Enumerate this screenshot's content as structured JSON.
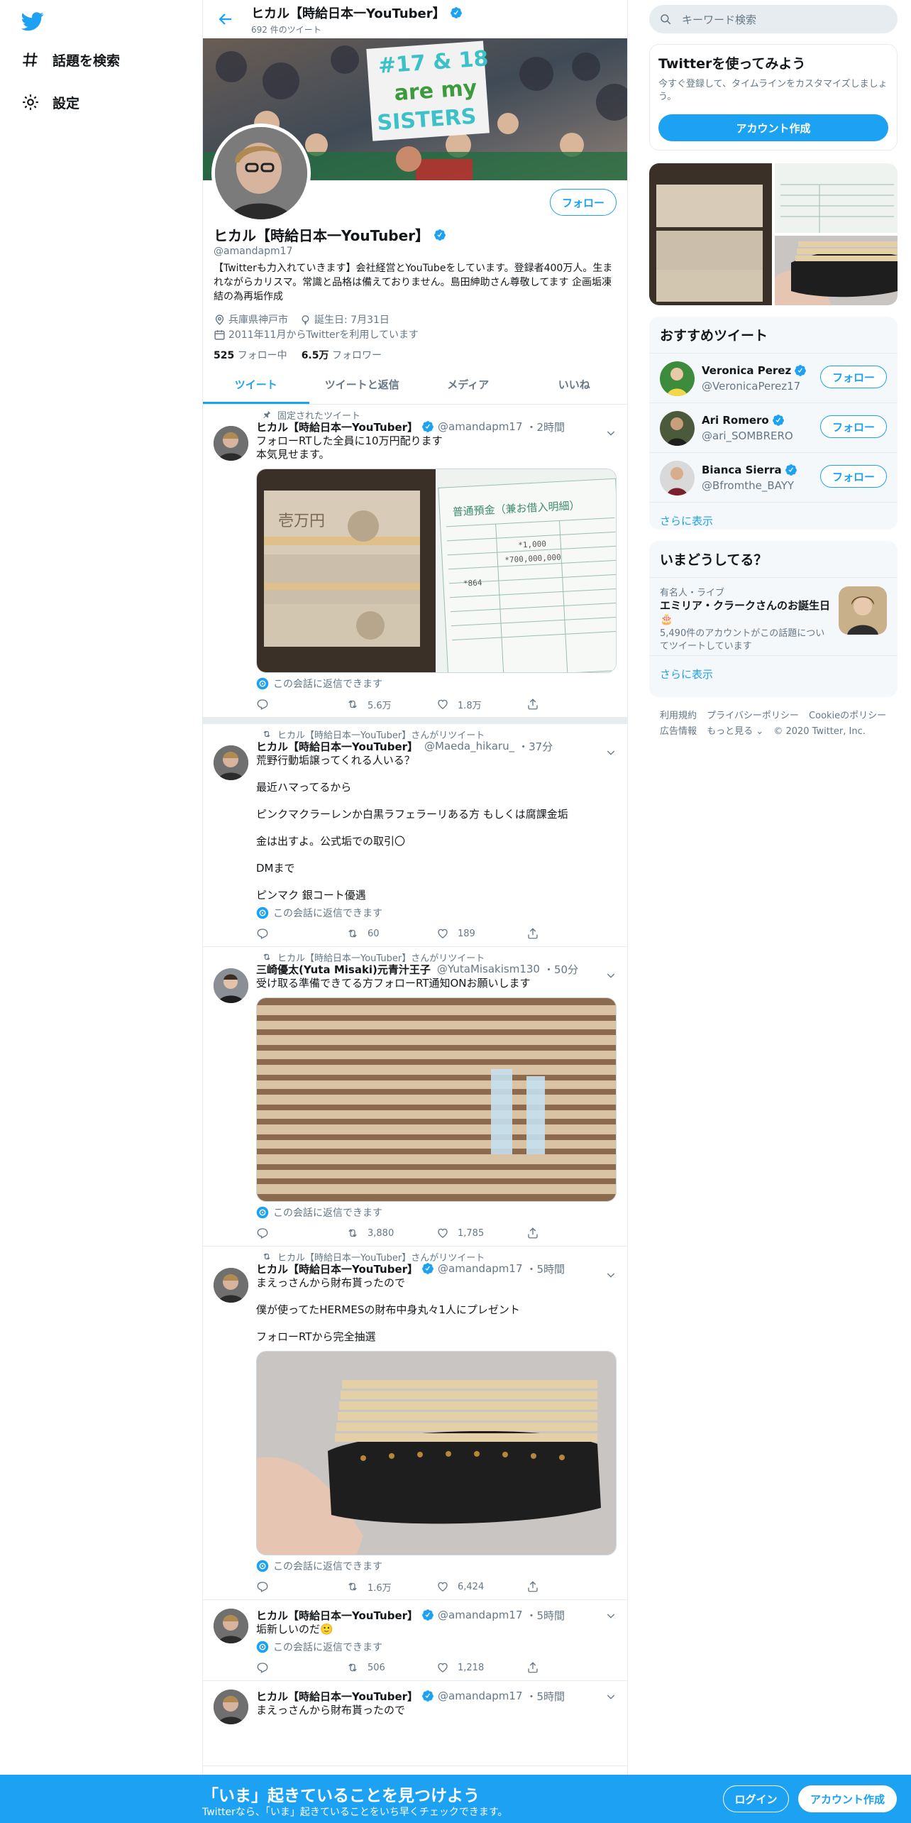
{
  "nav": {
    "logo": "twitter-bird-icon",
    "items": [
      {
        "label": "話題を検索",
        "icon": "hashtag-icon"
      },
      {
        "label": "設定",
        "icon": "gear-icon"
      }
    ]
  },
  "header": {
    "name": "ヒカル【時給日本一YouTuber】",
    "tweet_count": "692 件のツイート"
  },
  "banner": {
    "sign_line1": "#17 & 18",
    "sign_line2": "are my",
    "sign_line3": "SISTERS"
  },
  "profile": {
    "follow_label": "フォロー",
    "name": "ヒカル【時給日本一YouTuber】",
    "handle": "@amandapm17",
    "bio": "【Twitterも力入れていきます】会社経営とYouTubeをしています。登録者400万人。生まれながらカリスマ。常識と品格は備えておりません。島田紳助さん尊敬してます 企画垢凍結の為再垢作成",
    "location": "兵庫県神戸市",
    "birthday": "誕生日: 7月31日",
    "joined": "2011年11月からTwitterを利用しています",
    "following_count": "525",
    "following_label": "フォロー中",
    "followers_count": "6.5万",
    "followers_label": "フォロワー"
  },
  "tabs": [
    "ツイート",
    "ツイートと返信",
    "メディア",
    "いいね"
  ],
  "tweets": [
    {
      "context": "固定されたツイート",
      "name": "ヒカル【時給日本一YouTuber】",
      "handle": "@amandapm17",
      "time": "・2時間",
      "text": "フォローRTした全員に10万円配ります\n本気見せます。",
      "reply_note": "この会話に返信できます",
      "retweets": "5.6万",
      "likes": "1.8万",
      "media": {
        "bank_header": "普通預金（兼お借入明細）",
        "amount1": "*1,000",
        "amount2": "*700,000,000",
        "amount3": "*864"
      }
    },
    {
      "context": "ヒカル【時給日本一YouTuber】さんがリツイート",
      "name": "ヒカル【時給日本一YouTuber】",
      "handle": "@Maeda_hikaru_",
      "time": "・37分",
      "text": "荒野行動垢譲ってくれる人いる？\n\n最近ハマってるから\n\nピンクマクラーレンか白黒ラフェラーリある方 もしくは腐課金垢\n\n金は出すよ。公式垢での取引〇\n\nDMまで\n\nピンマク 銀コート優遇",
      "reply_note": "この会話に返信できます",
      "retweets": "60",
      "likes": "189"
    },
    {
      "context": "ヒカル【時給日本一YouTuber】さんがリツイート",
      "name": "三崎優太(Yuta Misaki)元青汁王子",
      "handle": "@YutaMisakism130",
      "time": "・50分",
      "text": "受け取る準備できてる方フォローRT通知ONお願いします",
      "reply_note": "この会話に返信できます",
      "retweets": "3,880",
      "likes": "1,785"
    },
    {
      "context": "ヒカル【時給日本一YouTuber】さんがリツイート",
      "name": "ヒカル【時給日本一YouTuber】",
      "handle": "@amandapm17",
      "time": "・5時間",
      "text": "まえっさんから財布貰ったので\n\n僕が使ってたHERMESの財布中身丸々1人にプレゼント\n\nフォローRTから完全抽選",
      "reply_note": "この会話に返信できます",
      "retweets": "1.6万",
      "likes": "6,424"
    },
    {
      "context": "",
      "name": "ヒカル【時給日本一YouTuber】",
      "handle": "@amandapm17",
      "time": "・5時間",
      "text": "垢新しいのだ🙂",
      "reply_note": "この会話に返信できます",
      "retweets": "506",
      "likes": "1,218"
    },
    {
      "context": "",
      "name": "ヒカル【時給日本一YouTuber】",
      "handle": "@amandapm17",
      "time": "・5時間",
      "text": "まえっさんから財布貰ったので"
    }
  ],
  "search": {
    "placeholder": "キーワード検索"
  },
  "signup_card": {
    "title": "Twitterを使ってみよう",
    "subtitle": "今すぐ登録して、タイムラインをカスタマイズしましょう。",
    "button": "アカウント作成"
  },
  "recommended": {
    "title": "おすすめツイート",
    "users": [
      {
        "name": "Veronica Perez",
        "handle": "@VeronicaPerez17"
      },
      {
        "name": "Ari Romero",
        "handle": "@ari_SOMBRERO"
      },
      {
        "name": "Bianca Sierra",
        "handle": "@Bfromthe_BAYY"
      }
    ],
    "follow_label": "フォロー",
    "more": "さらに表示"
  },
  "trends": {
    "title": "いまどうしてる？",
    "category": "有名人・ライブ",
    "headline": "エミリア・クラークさんのお誕生日🎂",
    "desc": "5,490件のアカウントがこの話題についてツイートしています",
    "more": "さらに表示"
  },
  "footer": {
    "links": [
      "利用規約",
      "プライバシーポリシー",
      "Cookieのポリシー",
      "広告情報",
      "もっと見る ⌄",
      "© 2020 Twitter, Inc."
    ]
  },
  "bottom_bar": {
    "title": "「いま」起きていることを見つけよう",
    "subtitle": "Twitterなら、「いま」起きていることをいち早くチェックできます。",
    "login": "ログイン",
    "signup": "アカウント作成"
  },
  "colors": {
    "accent": "#1da1f2",
    "text": "#14171a",
    "muted": "#657786",
    "border": "#e6ecf0"
  }
}
